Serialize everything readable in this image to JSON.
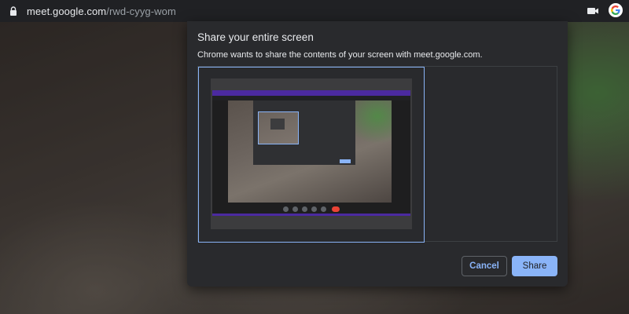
{
  "browser": {
    "url_host": "meet.google.com",
    "url_path": "/rwd-cyyg-wom",
    "icons": [
      "lock-icon",
      "camera-icon",
      "google-account-icon"
    ]
  },
  "dialog": {
    "title": "Share your entire screen",
    "description": "Chrome wants to share the contents of your screen with meet.google.com.",
    "cancel_label": "Cancel",
    "share_label": "Share",
    "selected_source": "entire-screen",
    "colors": {
      "accent": "#8ab4f8",
      "dialog_bg": "#292a2d",
      "text": "#e8eaed"
    }
  }
}
